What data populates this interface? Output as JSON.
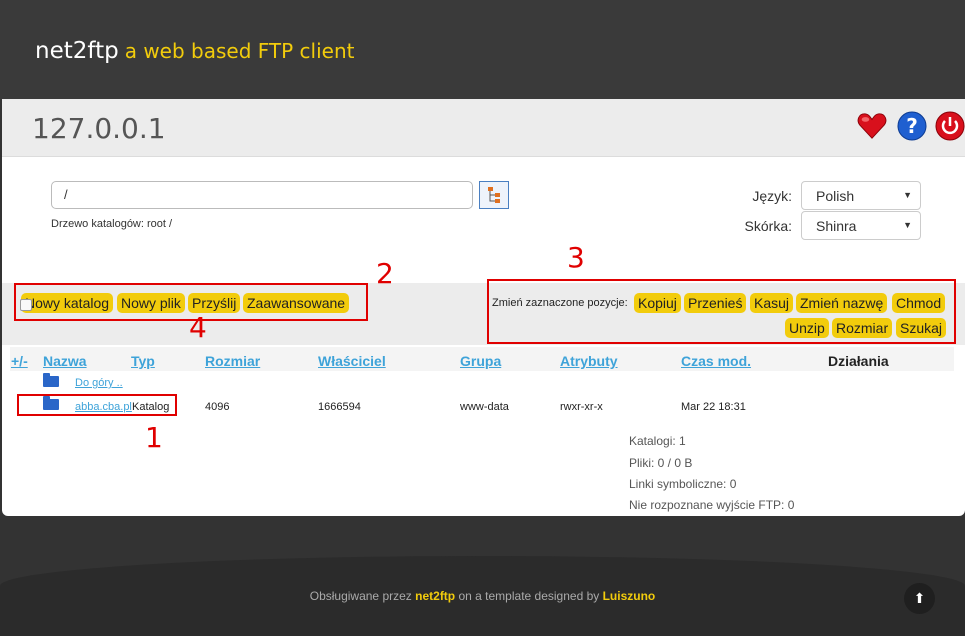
{
  "header": {
    "app_name": "net2ftp",
    "tagline": "a web based FTP client"
  },
  "host": {
    "name": "127.0.0.1"
  },
  "icons": {
    "bookmark": "heart-icon",
    "help": "help-icon",
    "logout": "power-icon",
    "tree": "tree-icon",
    "folder": "folder-icon",
    "up": "arrow-up-icon"
  },
  "colors": {
    "accent": "#f2cc0c",
    "link": "#3ea3d9",
    "annotation": "#e00000"
  },
  "path": {
    "value": "/",
    "tree_label": "Drzewo katalogów: root /"
  },
  "settings": {
    "language_label": "Język:",
    "language_value": "Polish",
    "skin_label": "Skórka:",
    "skin_value": "Shinra"
  },
  "actions": {
    "left": [
      "Nowy katalog",
      "Nowy plik",
      "Przyślij",
      "Zaawansowane"
    ],
    "selected_label": "Zmień zaznaczone pozycje:",
    "right": [
      "Kopiuj",
      "Przenieś",
      "Kasuj",
      "Zmień nazwę",
      "Chmod",
      "Unzip",
      "Rozmiar",
      "Szukaj"
    ]
  },
  "table": {
    "headers": [
      "+/-",
      "Nazwa",
      "Typ",
      "Rozmiar",
      "Właściciel",
      "Grupa",
      "Atrybuty",
      "Czas mod.",
      "Działania"
    ],
    "up_label": "Do góry ..",
    "row": {
      "name": "abba.cba.pl",
      "type": "Katalog",
      "size": "4096",
      "owner": "1666594",
      "group": "www-data",
      "attributes": "rwxr-xr-x",
      "mtime": "Mar 22 18:31"
    }
  },
  "stats": [
    "Katalogi: 1",
    "Pliki: 0 / 0 B",
    "Linki symboliczne: 0",
    "Nie rozpoznane wyjście FTP: 0"
  ],
  "annotations": [
    "1",
    "2",
    "3",
    "4"
  ],
  "footer": {
    "prefix": "Obsługiwane przez",
    "brand": "net2ftp",
    "middle": "on a template designed by",
    "author": "Luiszuno"
  }
}
